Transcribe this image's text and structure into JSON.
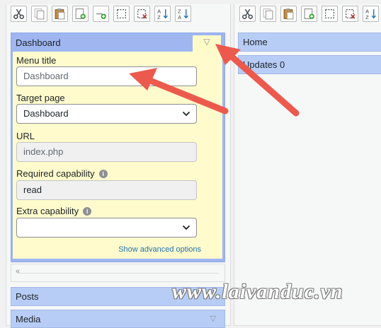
{
  "left_toolbar": {
    "buttons": [
      {
        "icon": "cut-icon"
      },
      {
        "icon": "copy-icon"
      },
      {
        "icon": "paste-icon"
      },
      {
        "icon": "new-menu-icon"
      },
      {
        "icon": "new-separator-icon"
      },
      {
        "icon": "selection-icon"
      },
      {
        "icon": "delete-icon"
      },
      {
        "icon": "sort-ascending-icon"
      },
      {
        "icon": "sort-descending-icon"
      }
    ]
  },
  "right_toolbar": {
    "buttons": [
      {
        "icon": "cut-icon"
      },
      {
        "icon": "copy-icon"
      },
      {
        "icon": "paste-icon"
      },
      {
        "icon": "new-menu-icon"
      },
      {
        "icon": "selection-icon"
      },
      {
        "icon": "delete-icon"
      },
      {
        "icon": "sort-ascending-icon"
      }
    ]
  },
  "dashboard": {
    "title": "Dashboard",
    "toggle_glyph": "▽",
    "menu_title_label": "Menu title",
    "menu_title_placeholder": "Dashboard",
    "target_page_label": "Target page",
    "target_page_value": "Dashboard",
    "url_label": "URL",
    "url_value": "index.php",
    "required_cap_label": "Required capability",
    "required_cap_value": "read",
    "extra_cap_label": "Extra capability",
    "extra_cap_value": "",
    "help_glyph": "i",
    "advanced_link": "Show advanced options"
  },
  "left_menu": {
    "posts": "Posts",
    "media": "Media",
    "media_arrow": "▽"
  },
  "right_menu": {
    "home": "Home",
    "updates": "Updates 0"
  },
  "scroll_glyph": "«",
  "watermark": "www.laivanduc.vn",
  "colors": {
    "menu_item_bg": "#b8cdf6",
    "editor_bg": "#fffbcc",
    "link": "#2271b1",
    "arrow": "#ec5a4d"
  }
}
